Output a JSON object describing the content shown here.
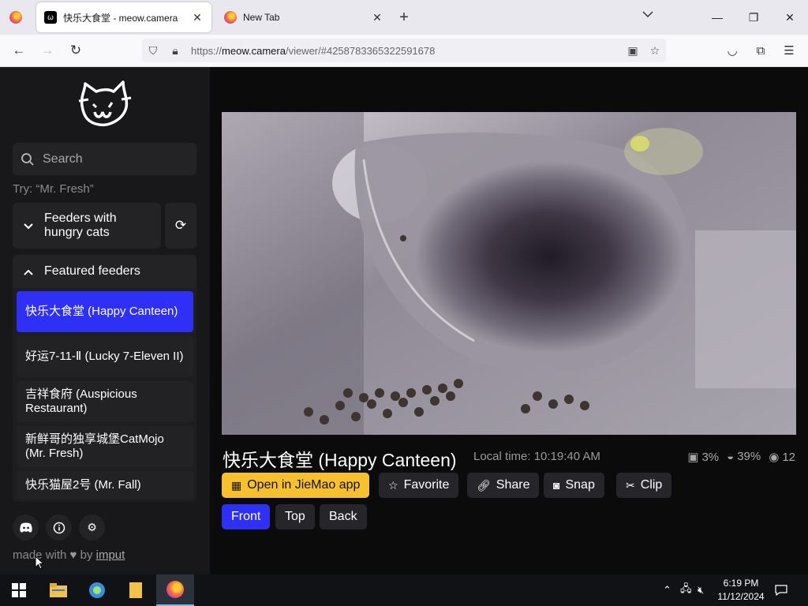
{
  "browser": {
    "tabs": [
      {
        "title": "快乐大食堂 - meow.camera",
        "active": true
      },
      {
        "title": "New Tab",
        "active": false
      }
    ],
    "url_prefix": "https://",
    "url_domain": "meow.camera",
    "url_rest": "/viewer/#4258783365322591678"
  },
  "sidebar": {
    "search_placeholder": "Search",
    "search_hint": "Try: “Mr. Fresh”",
    "hungry_group_label": "Feeders with hungry cats",
    "featured_group_label": "Featured feeders",
    "feeders": [
      {
        "name": "快乐大食堂 (Happy Canteen)",
        "active": true
      },
      {
        "name": "好运7-11-Ⅱ (Lucky 7-Eleven II)",
        "active": false
      },
      {
        "name": "吉祥食府 (Auspicious Restaurant)",
        "active": false
      },
      {
        "name": "新鲜哥的独享城堡CatMojo (Mr. Fresh)",
        "active": false
      },
      {
        "name": "快乐猫屋2号 (Mr. Fall)",
        "active": false
      }
    ],
    "footer_prefix": "made with",
    "footer_by": "by",
    "footer_author": "imput"
  },
  "camera": {
    "title": "快乐大食堂 (Happy Canteen)",
    "local_time": "Local time: 10:19:40 AM",
    "food_level": "3%",
    "bowl_level": "39%",
    "viewers": "12"
  },
  "actions": {
    "open_app": "Open in JieMao app",
    "favorite": "Favorite",
    "share": "Share",
    "snap": "Snap",
    "clip": "Clip"
  },
  "views": [
    {
      "label": "Front",
      "active": true
    },
    {
      "label": "Top",
      "active": false
    },
    {
      "label": "Back",
      "active": false
    }
  ],
  "taskbar": {
    "time": "6:19 PM",
    "date": "11/12/2024"
  },
  "colors": {
    "accent": "#2f30f5",
    "app_button": "#f6c02e",
    "sidebar_bg": "#18181a"
  }
}
